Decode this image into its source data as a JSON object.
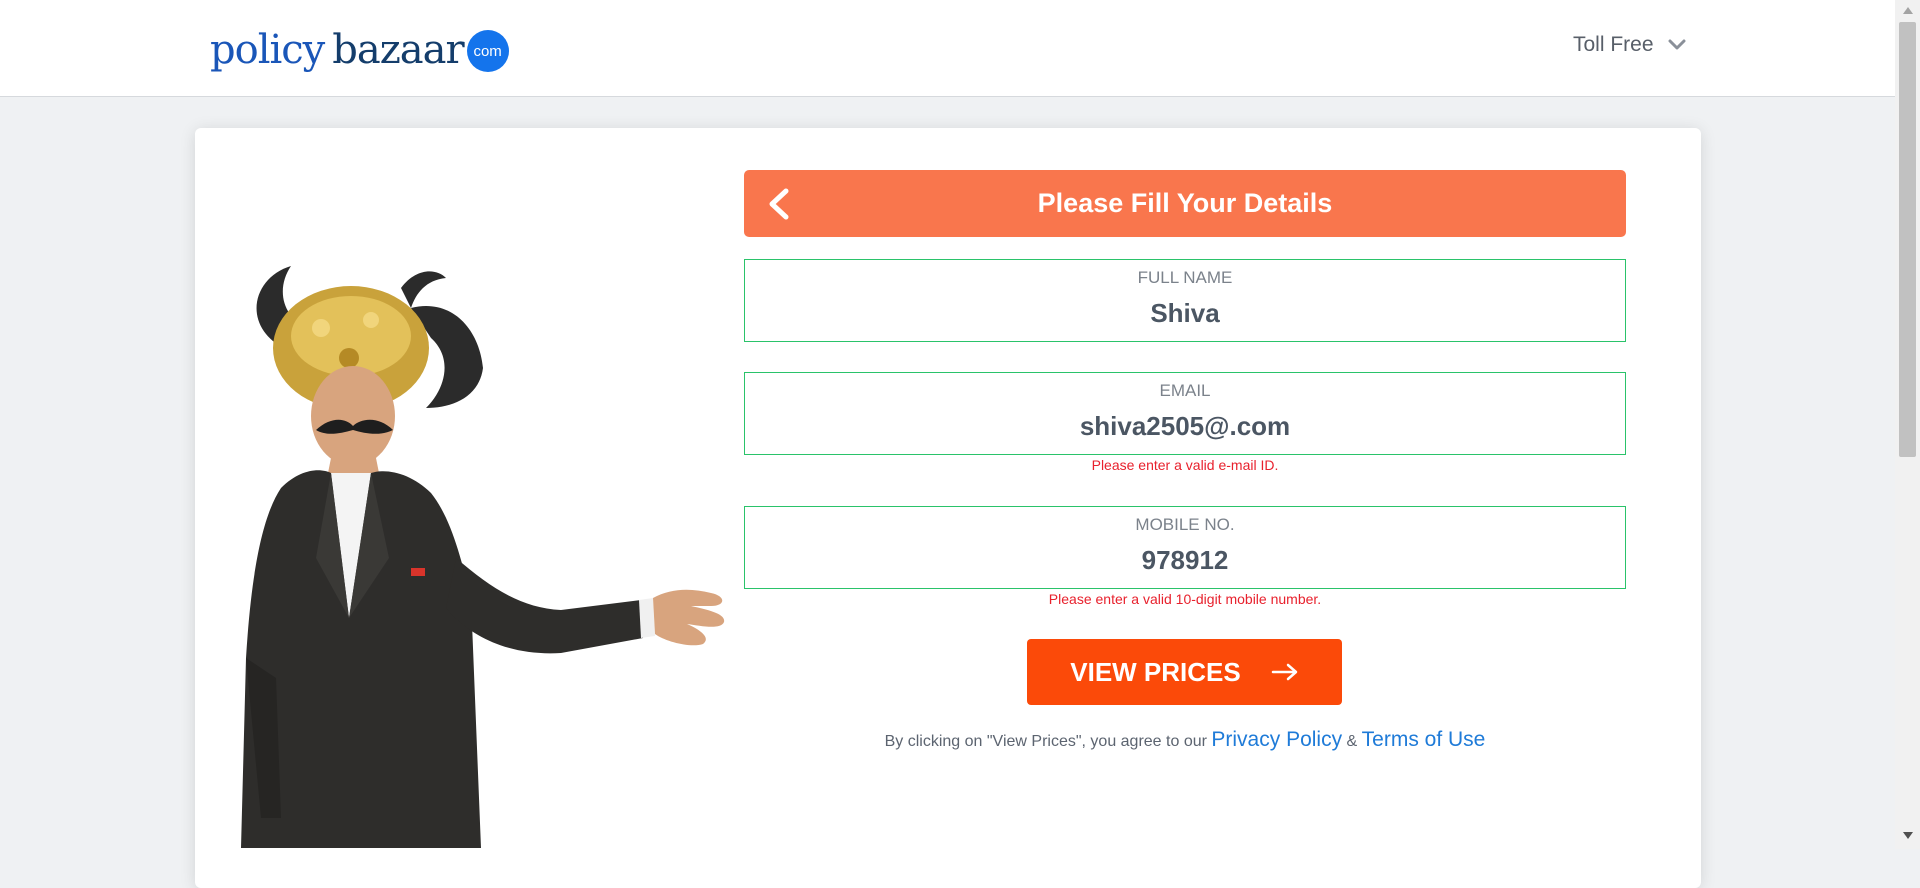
{
  "header": {
    "logo": {
      "word1": "policy",
      "word2": "bazaar",
      "badge": "com"
    },
    "toll_free_label": "Toll Free",
    "dropdown_icon": "chevron-down-icon"
  },
  "form": {
    "title": "Please Fill Your Details",
    "back_icon": "chevron-left-icon",
    "full_name": {
      "label": "FULL NAME",
      "value": "Shiva"
    },
    "email": {
      "label": "EMAIL",
      "value": "shiva2505@.com",
      "error": "Please enter a valid e-mail ID."
    },
    "mobile": {
      "label": "MOBILE NO.",
      "value": "978912",
      "error": "Please enter a valid 10-digit mobile number."
    },
    "submit_label": "VIEW PRICES",
    "submit_icon": "arrow-right-icon",
    "terms_prefix": "By clicking on \"View Prices\", you agree to our",
    "privacy_link": "Privacy Policy",
    "ampersand": "&",
    "terms_link": "Terms of Use"
  },
  "colors": {
    "brand_blue": "#1474ec",
    "header_orange": "#f9764d",
    "button_orange": "#fb4a09",
    "field_border": "#2ac36a",
    "error_red": "#e8212d",
    "link_blue": "#1f7bd8"
  }
}
